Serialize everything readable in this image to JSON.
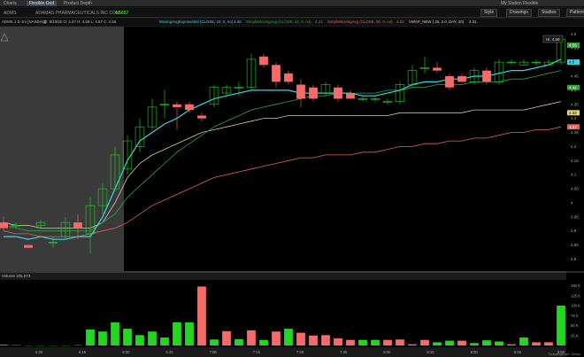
{
  "tabs": [
    "Charts",
    "Flexible Grid",
    "Product Depth"
  ],
  "window": {
    "right_label": "My Station Flexible"
  },
  "toolbar": {
    "symbol": "ADMS",
    "company": "ADAMAS PHARMACEUTICALS INC COM",
    "last_price": "4.5657",
    "buttons": [
      "Style",
      "Drawings",
      "Studies",
      "Patterns"
    ]
  },
  "studies": {
    "header": "ADMS 1 D 1m [NASDAQ]",
    "ohlc": "D: 8/10/20  O: 4.47  H: 4.59  L: 4.57  C: 4.56",
    "items": [
      {
        "label": "MovingAvgExponential (CLOSE, 10, 0, no)",
        "value": "4.46",
        "color": "#36d6e7"
      },
      {
        "label": "SimpleMovingAvg (CLOSE, 21, 0, no)",
        "value": "4.31",
        "color": "#2fa53a"
      },
      {
        "label": "SimpleMovingAvg (CLOSE, 50, 0, no)",
        "value": "4.22",
        "color": "#e0605a"
      },
      {
        "label": "VWAP_NEW (.25, 2.0, DAY, 20)",
        "value": "4.31",
        "color": "#d8c8a8"
      }
    ]
  },
  "price_axis": {
    "hi_badge": "Hi: 4.59",
    "labels": [
      "4.6",
      "4.55",
      "4.5",
      "4.45",
      "4.4",
      "4.35",
      "4.3",
      "4.25",
      "4.2",
      "4.15",
      "4.1",
      "4.05",
      "4",
      "3.95",
      "3.9",
      "3.85",
      "3.8"
    ],
    "markers": [
      {
        "text": "4.56",
        "y": 4.56,
        "bg": "#2fa53a",
        "fg": "#ffffff"
      },
      {
        "text": "4.5",
        "y": 4.5,
        "bg": "#36d6e7",
        "fg": "#000000"
      },
      {
        "text": "4.41",
        "y": 4.41,
        "bg": "#2fa53a",
        "fg": "#ffffff"
      },
      {
        "text": "4.32",
        "y": 4.32,
        "bg": "#e7d36e",
        "fg": "#000000"
      },
      {
        "text": "4.27",
        "y": 4.27,
        "bg": "#e0605a",
        "fg": "#ffffff"
      }
    ]
  },
  "volume": {
    "label": "Volume",
    "value": "105,073",
    "axis": [
      "150 K",
      "125 K",
      "100 K",
      "75 K",
      "50 K",
      "25 K"
    ]
  },
  "time_axis": [
    "5:30",
    "6:15",
    "6:30",
    "6:45",
    "7:00",
    "7:15",
    "7:30",
    "7:45",
    "8:00",
    "8:15",
    "8:30",
    "8:45",
    "9:00"
  ],
  "footer_text": "Drawings set: Defau",
  "colors": {
    "up": "#22d622",
    "down": "#f76a6a",
    "ema": "#36d6e7",
    "sma21": "#2fa53a",
    "sma50": "#e0605a",
    "vwap": "#d8c8a8"
  },
  "chart_data": {
    "type": "candlestick",
    "ylim": [
      3.77,
      4.62
    ],
    "candles": [
      {
        "o": 3.93,
        "c": 3.91,
        "h": 3.95,
        "l": 3.9
      },
      {
        "o": 3.92,
        "c": 3.92,
        "h": 3.93,
        "l": 3.91
      },
      {
        "o": 3.85,
        "c": 3.84,
        "h": 3.85,
        "l": 3.84
      },
      {
        "o": 3.92,
        "c": 3.93,
        "h": 3.94,
        "l": 3.91
      },
      {
        "o": 3.86,
        "c": 3.86,
        "h": 3.88,
        "l": 3.84
      },
      {
        "o": 3.88,
        "c": 3.93,
        "h": 3.95,
        "l": 3.87
      },
      {
        "o": 3.93,
        "c": 3.91,
        "h": 3.96,
        "l": 3.87
      },
      {
        "o": 3.89,
        "c": 3.99,
        "h": 4.02,
        "l": 3.82
      },
      {
        "o": 3.99,
        "c": 4.05,
        "h": 4.07,
        "l": 3.96
      },
      {
        "o": 4.05,
        "c": 4.17,
        "h": 4.2,
        "l": 4.04
      },
      {
        "o": 4.12,
        "c": 4.22,
        "h": 4.24,
        "l": 4.1
      },
      {
        "o": 4.2,
        "c": 4.27,
        "h": 4.3,
        "l": 4.18
      },
      {
        "o": 4.27,
        "c": 4.34,
        "h": 4.37,
        "l": 4.26
      },
      {
        "o": 4.35,
        "c": 4.35,
        "h": 4.4,
        "l": 4.3
      },
      {
        "o": 4.35,
        "c": 4.34,
        "h": 4.36,
        "l": 4.26
      },
      {
        "o": 4.35,
        "c": 4.33,
        "h": 4.36,
        "l": 4.32
      },
      {
        "o": 4.31,
        "c": 4.3,
        "h": 4.32,
        "l": 4.29
      },
      {
        "o": 4.35,
        "c": 4.41,
        "h": 4.42,
        "l": 4.34
      },
      {
        "o": 4.39,
        "c": 4.41,
        "h": 4.42,
        "l": 4.38
      },
      {
        "o": 4.41,
        "c": 4.41,
        "h": 4.43,
        "l": 4.38
      },
      {
        "o": 4.41,
        "c": 4.51,
        "h": 4.53,
        "l": 4.4
      },
      {
        "o": 4.52,
        "c": 4.49,
        "h": 4.53,
        "l": 4.48
      },
      {
        "o": 4.49,
        "c": 4.43,
        "h": 4.5,
        "l": 4.41
      },
      {
        "o": 4.46,
        "c": 4.43,
        "h": 4.47,
        "l": 4.42
      },
      {
        "o": 4.42,
        "c": 4.37,
        "h": 4.44,
        "l": 4.34
      },
      {
        "o": 4.41,
        "c": 4.37,
        "h": 4.42,
        "l": 4.36
      },
      {
        "o": 4.39,
        "c": 4.42,
        "h": 4.43,
        "l": 4.38
      },
      {
        "o": 4.41,
        "c": 4.37,
        "h": 4.42,
        "l": 4.36
      },
      {
        "o": 4.39,
        "c": 4.37,
        "h": 4.4,
        "l": 4.37
      },
      {
        "o": 4.37,
        "c": 4.37,
        "h": 4.38,
        "l": 4.36
      },
      {
        "o": 4.37,
        "c": 4.37,
        "h": 4.38,
        "l": 4.36
      },
      {
        "o": 4.36,
        "c": 4.36,
        "h": 4.37,
        "l": 4.35
      },
      {
        "o": 4.36,
        "c": 4.42,
        "h": 4.43,
        "l": 4.35
      },
      {
        "o": 4.42,
        "c": 4.47,
        "h": 4.49,
        "l": 4.41
      },
      {
        "o": 4.48,
        "c": 4.48,
        "h": 4.52,
        "l": 4.46
      },
      {
        "o": 4.48,
        "c": 4.47,
        "h": 4.5,
        "l": 4.46
      },
      {
        "o": 4.45,
        "c": 4.41,
        "h": 4.46,
        "l": 4.4
      },
      {
        "o": 4.45,
        "c": 4.43,
        "h": 4.46,
        "l": 4.43
      },
      {
        "o": 4.43,
        "c": 4.47,
        "h": 4.48,
        "l": 4.42
      },
      {
        "o": 4.47,
        "c": 4.43,
        "h": 4.48,
        "l": 4.42
      },
      {
        "o": 4.43,
        "c": 4.5,
        "h": 4.51,
        "l": 4.42
      },
      {
        "o": 4.5,
        "c": 4.5,
        "h": 4.51,
        "l": 4.49
      },
      {
        "o": 4.49,
        "c": 4.5,
        "h": 4.51,
        "l": 4.49
      },
      {
        "o": 4.5,
        "c": 4.5,
        "h": 4.51,
        "l": 4.49
      },
      {
        "o": 4.49,
        "c": 4.5,
        "h": 4.51,
        "l": 4.49
      },
      {
        "o": 4.5,
        "c": 4.58,
        "h": 4.59,
        "l": 4.49
      }
    ],
    "volume": [
      2,
      1,
      0,
      0,
      0,
      0,
      1,
      40,
      35,
      58,
      42,
      26,
      35,
      20,
      58,
      58,
      148,
      15,
      36,
      16,
      38,
      14,
      35,
      42,
      32,
      25,
      26,
      18,
      14,
      14,
      14,
      14,
      15,
      3,
      14,
      8,
      12,
      12,
      6,
      13,
      10,
      3,
      20,
      8,
      8,
      100
    ],
    "volume_up": [
      true,
      true,
      true,
      true,
      true,
      true,
      true,
      true,
      true,
      true,
      true,
      true,
      true,
      true,
      true,
      true,
      false,
      true,
      false,
      true,
      false,
      true,
      false,
      true,
      false,
      false,
      false,
      false,
      false,
      true,
      true,
      false,
      false,
      false,
      false,
      true,
      true,
      false,
      true,
      true,
      true,
      false,
      true,
      false,
      false,
      true
    ],
    "ema10": [
      3.88,
      3.88,
      3.87,
      3.88,
      3.87,
      3.87,
      3.88,
      3.88,
      3.95,
      4.05,
      4.15,
      4.22,
      4.25,
      4.28,
      4.3,
      4.33,
      4.35,
      4.37,
      4.38,
      4.39,
      4.4,
      4.4,
      4.4,
      4.4,
      4.39,
      4.39,
      4.39,
      4.39,
      4.39,
      4.38,
      4.38,
      4.39,
      4.4,
      4.42,
      4.43,
      4.43,
      4.44,
      4.44,
      4.45,
      4.45,
      4.46,
      4.47,
      4.47,
      4.48,
      4.49,
      4.51
    ],
    "sma21": [
      3.92,
      3.91,
      3.9,
      3.9,
      3.9,
      3.9,
      3.9,
      3.9,
      3.93,
      3.96,
      4.02,
      4.06,
      4.1,
      4.14,
      4.18,
      4.21,
      4.24,
      4.27,
      4.29,
      4.31,
      4.33,
      4.34,
      4.35,
      4.36,
      4.37,
      4.38,
      4.38,
      4.39,
      4.39,
      4.39,
      4.39,
      4.4,
      4.4,
      4.41,
      4.41,
      4.42,
      4.42,
      4.42,
      4.43,
      4.43,
      4.43,
      4.44,
      4.44,
      4.45,
      4.46,
      4.47
    ],
    "sma50": [
      3.9,
      3.89,
      3.89,
      3.88,
      3.88,
      3.88,
      3.88,
      3.89,
      3.9,
      3.91,
      3.93,
      3.96,
      3.99,
      4.01,
      4.03,
      4.05,
      4.07,
      4.09,
      4.1,
      4.11,
      4.12,
      4.13,
      4.14,
      4.15,
      4.16,
      4.16,
      4.17,
      4.17,
      4.17,
      4.18,
      4.18,
      4.19,
      4.2,
      4.2,
      4.21,
      4.21,
      4.22,
      4.22,
      4.23,
      4.23,
      4.24,
      4.25,
      4.25,
      4.26,
      4.26,
      4.27
    ],
    "vwap": [
      3.93,
      3.92,
      3.92,
      3.91,
      3.91,
      3.91,
      3.91,
      3.91,
      3.93,
      4.0,
      4.09,
      4.14,
      4.17,
      4.19,
      4.21,
      4.23,
      4.25,
      4.26,
      4.27,
      4.28,
      4.29,
      4.3,
      4.3,
      4.31,
      4.31,
      4.31,
      4.31,
      4.31,
      4.31,
      4.31,
      4.31,
      4.31,
      4.32,
      4.32,
      4.32,
      4.32,
      4.32,
      4.32,
      4.33,
      4.33,
      4.33,
      4.33,
      4.33,
      4.34,
      4.35,
      4.36
    ]
  }
}
